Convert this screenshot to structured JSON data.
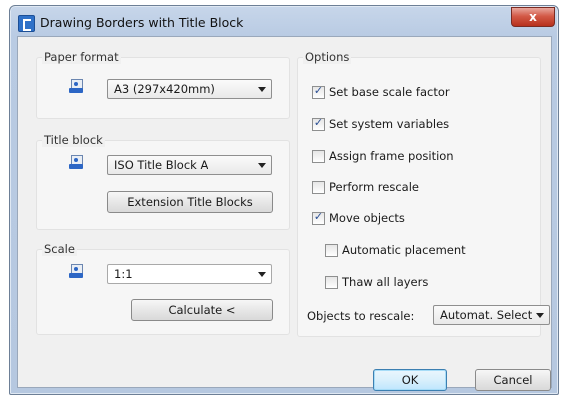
{
  "window": {
    "title": "Drawing Borders with Title Block",
    "close_label": "x"
  },
  "paper_format": {
    "label": "Paper format",
    "value": "A3 (297x420mm)"
  },
  "title_block": {
    "label": "Title block",
    "value": "ISO Title Block A",
    "extension_button": "Extension Title Blocks"
  },
  "scale": {
    "label": "Scale",
    "value": "1:1",
    "calculate_button": "Calculate <"
  },
  "options": {
    "label": "Options",
    "items": [
      {
        "label": "Set base scale factor",
        "checked": true
      },
      {
        "label": "Set system variables",
        "checked": true
      },
      {
        "label": "Assign frame position",
        "checked": false
      },
      {
        "label": "Perform rescale",
        "checked": false
      },
      {
        "label": "Move objects",
        "checked": true
      },
      {
        "label": "Automatic placement",
        "checked": false
      },
      {
        "label": "Thaw all layers",
        "checked": false
      }
    ],
    "rescale_label": "Objects to rescale:",
    "rescale_value": "Automat. Selectic"
  },
  "buttons": {
    "ok": "OK",
    "cancel": "Cancel"
  },
  "check_glyph": "✓"
}
